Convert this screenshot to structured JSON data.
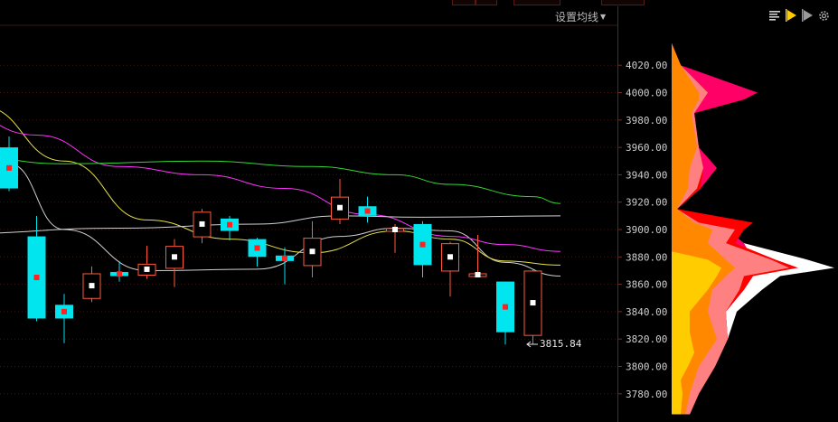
{
  "toolbar": {
    "ma_settings_label": "设置均线",
    "icons": [
      "bar-lines-icon",
      "play-yellow-icon",
      "play-gray-icon",
      "gear-icon"
    ]
  },
  "price_axis": {
    "labels": [
      "4020.00",
      "4000.00",
      "3980.00",
      "3960.00",
      "3940.00",
      "3920.00",
      "3900.00",
      "3880.00",
      "3860.00",
      "3840.00",
      "3820.00",
      "3800.00",
      "3780.00"
    ],
    "values": [
      4020,
      4000,
      3980,
      3960,
      3940,
      3920,
      3900,
      3880,
      3860,
      3840,
      3820,
      3800,
      3780
    ]
  },
  "last_price_label": "3815.84",
  "colors": {
    "bg": "#000000",
    "grid": "#3a1a14",
    "up": "#ff5a3c",
    "down": "#00e5ee",
    "ma_white": "#d0d0d0",
    "ma_yellow": "#e6e24a",
    "ma_magenta": "#ff33ff",
    "ma_green": "#33d633",
    "profile_layers": [
      "#ffcc00",
      "#ff8800",
      "#ff8080",
      "#ff0000",
      "#ff0066",
      "#ffffff"
    ]
  },
  "chart_data": {
    "type": "candlestick",
    "title": "",
    "ylim": [
      3765,
      4035
    ],
    "candles": [
      {
        "o": 3930,
        "c": 3960,
        "h": 3968,
        "l": 3928,
        "dir": "down"
      },
      {
        "o": 3895,
        "c": 3835,
        "h": 3910,
        "l": 3833,
        "dir": "down"
      },
      {
        "o": 3845,
        "c": 3835,
        "h": 3853,
        "l": 3817,
        "dir": "down"
      },
      {
        "o": 3850,
        "c": 3868,
        "h": 3873,
        "l": 3847,
        "dir": "up"
      },
      {
        "o": 3866,
        "c": 3869,
        "h": 3877,
        "l": 3862,
        "dir": "down"
      },
      {
        "o": 3867,
        "c": 3875,
        "h": 3888,
        "l": 3864,
        "dir": "up"
      },
      {
        "o": 3872,
        "c": 3888,
        "h": 3893,
        "l": 3858,
        "dir": "up"
      },
      {
        "o": 3895,
        "c": 3913,
        "h": 3915,
        "l": 3890,
        "dir": "up"
      },
      {
        "o": 3908,
        "c": 3899,
        "h": 3910,
        "l": 3892,
        "dir": "down"
      },
      {
        "o": 3893,
        "c": 3880,
        "h": 3894,
        "l": 3873,
        "dir": "down"
      },
      {
        "o": 3881,
        "c": 3877,
        "h": 3887,
        "l": 3860,
        "dir": "down"
      },
      {
        "o": 3874,
        "c": 3894,
        "h": 3906,
        "l": 3865,
        "dir": "up"
      },
      {
        "o": 3908,
        "c": 3924,
        "h": 3937,
        "l": 3904,
        "dir": "up"
      },
      {
        "o": 3917,
        "c": 3910,
        "h": 3924,
        "l": 3905,
        "dir": "down"
      },
      {
        "o": 3899,
        "c": 3901,
        "h": 3904,
        "l": 3883,
        "dir": "up"
      },
      {
        "o": 3904,
        "c": 3874,
        "h": 3906,
        "l": 3865,
        "dir": "down"
      },
      {
        "o": 3870,
        "c": 3890,
        "h": 3891,
        "l": 3851,
        "dir": "up"
      },
      {
        "o": 3866,
        "c": 3868,
        "h": 3896,
        "l": 3866,
        "dir": "up"
      },
      {
        "o": 3862,
        "c": 3825,
        "h": 3862,
        "l": 3816,
        "dir": "down"
      },
      {
        "o": 3823,
        "c": 3870,
        "h": 3871,
        "l": 3816,
        "dir": "up"
      }
    ],
    "ma_series": [
      {
        "color": "#d0d0d0",
        "values": [
          [
            0,
            3948
          ],
          [
            2,
            3900
          ],
          [
            5,
            3870
          ],
          [
            9,
            3871
          ],
          [
            12,
            3895
          ],
          [
            14,
            3901
          ],
          [
            16,
            3899
          ],
          [
            18,
            3876
          ],
          [
            20,
            3866
          ]
        ]
      },
      {
        "color": "#e6e24a",
        "values": [
          [
            -1,
            3990
          ],
          [
            2,
            3950
          ],
          [
            5,
            3907
          ],
          [
            8,
            3893
          ],
          [
            11,
            3883
          ],
          [
            14,
            3899
          ],
          [
            16,
            3893
          ],
          [
            18,
            3877
          ],
          [
            20,
            3874
          ]
        ]
      },
      {
        "color": "#ff33ff",
        "values": [
          [
            -2,
            3987
          ],
          [
            1,
            3969
          ],
          [
            4,
            3946
          ],
          [
            7,
            3940
          ],
          [
            10,
            3930
          ],
          [
            13,
            3911
          ],
          [
            16,
            3895
          ],
          [
            18,
            3889
          ],
          [
            20,
            3884
          ]
        ]
      },
      {
        "color": "#33d633",
        "values": [
          [
            -2,
            3955
          ],
          [
            2,
            3948
          ],
          [
            7,
            3950
          ],
          [
            11,
            3946
          ],
          [
            14,
            3940
          ],
          [
            16,
            3933
          ],
          [
            19,
            3924
          ],
          [
            20,
            3919
          ]
        ]
      },
      {
        "color": "#d0d0d0",
        "values": [
          [
            -2,
            3897
          ],
          [
            4,
            3901
          ],
          [
            9,
            3904
          ],
          [
            12,
            3910
          ],
          [
            15,
            3909
          ],
          [
            20,
            3910
          ]
        ]
      }
    ]
  }
}
